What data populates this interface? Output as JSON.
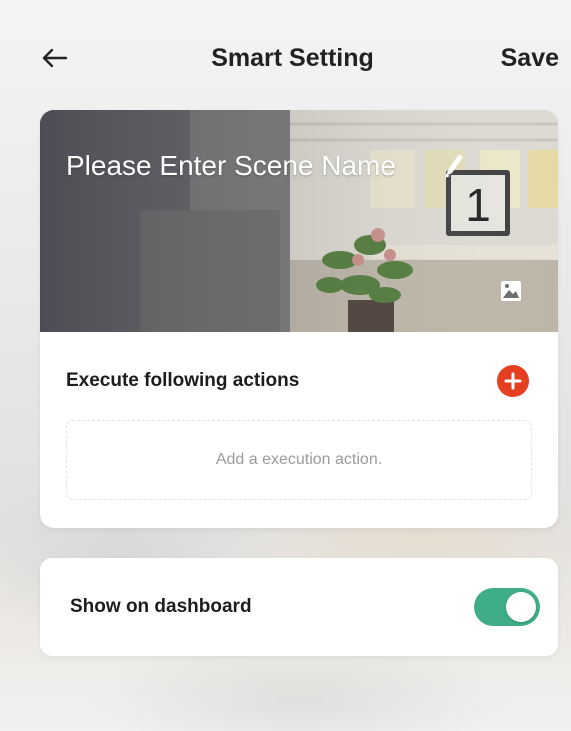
{
  "header": {
    "title": "Smart Setting",
    "save_label": "Save",
    "back_icon": "arrow-left-icon"
  },
  "scene": {
    "name_placeholder": "Please Enter Scene Name",
    "edit_icon": "pencil-icon",
    "image_icon": "image-icon",
    "clock_digit": "1"
  },
  "actions": {
    "title": "Execute following actions",
    "add_icon": "plus-circle-icon",
    "empty_text": "Add a execution action."
  },
  "dashboard": {
    "label": "Show on dashboard",
    "toggle_on": true
  },
  "colors": {
    "accent_red": "#e43f20",
    "toggle_green": "#3fae86"
  }
}
